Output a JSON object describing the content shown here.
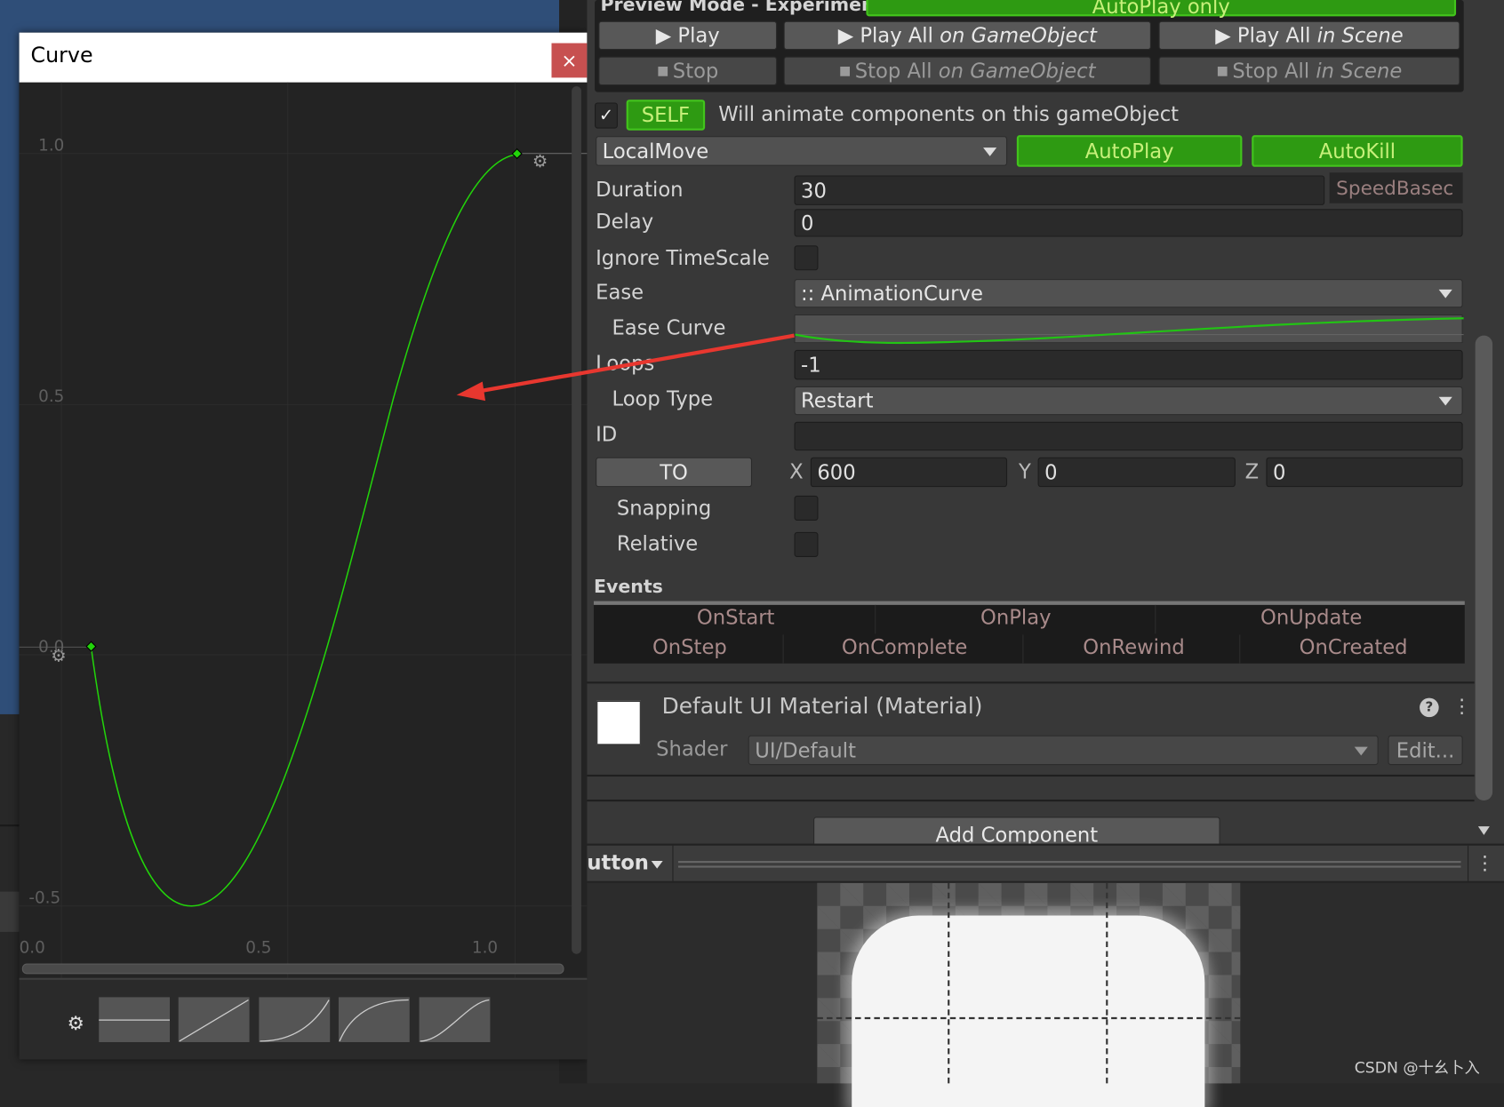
{
  "curve_window": {
    "title": "Curve",
    "close_label": "×",
    "y_ticks": [
      "1.0",
      "0.5",
      "0.0",
      "-0.5"
    ],
    "x_ticks": [
      "0.0",
      "0.5",
      "1.0"
    ],
    "curve_color": "#22d40a",
    "presets": [
      "flat",
      "linear",
      "ease-in",
      "ease-out",
      "ease-in-out"
    ]
  },
  "inspector": {
    "preview_mode": "Preview Mode - Experimental",
    "autoplay_only": "AutoPlay only",
    "play": "Play",
    "play_all": "Play All",
    "on_gameobject": "on GameObject",
    "in_scene": "in Scene",
    "stop": "Stop",
    "stop_all": "Stop All",
    "self_badge": "SELF",
    "self_text": "Will animate components on this gameObject",
    "self_checked": true,
    "animation_type": "LocalMove",
    "autoplay": "AutoPlay",
    "autokill": "AutoKill",
    "duration_label": "Duration",
    "duration": "30",
    "speed_based": "SpeedBasec",
    "delay_label": "Delay",
    "delay": "0",
    "ignore_timescale_label": "Ignore TimeScale",
    "ease_label": "Ease",
    "ease": ":: AnimationCurve",
    "ease_curve_label": "Ease Curve",
    "loops_label": "Loops",
    "loops": "-1",
    "loop_type_label": "Loop Type",
    "loop_type": "Restart",
    "id_label": "ID",
    "id": "",
    "to_button": "TO",
    "x_label": "X",
    "x": "600",
    "y_label": "Y",
    "y": "0",
    "z_label": "Z",
    "z": "0",
    "snapping_label": "Snapping",
    "relative_label": "Relative",
    "events_label": "Events",
    "events_row1": [
      "OnStart",
      "OnPlay",
      "OnUpdate"
    ],
    "events_row2": [
      "OnStep",
      "OnComplete",
      "OnRewind",
      "OnCreated"
    ]
  },
  "material": {
    "title": "Default UI Material (Material)",
    "shader_label": "Shader",
    "shader": "UI/Default",
    "edit": "Edit..."
  },
  "add_component": "Add Component",
  "preview_toolbar": {
    "title": "utton"
  },
  "watermark": "CSDN @十幺卜入",
  "colors": {
    "accent_green": "#2e9a12",
    "arrow_red": "#e8372f",
    "close_red": "#c75050"
  }
}
